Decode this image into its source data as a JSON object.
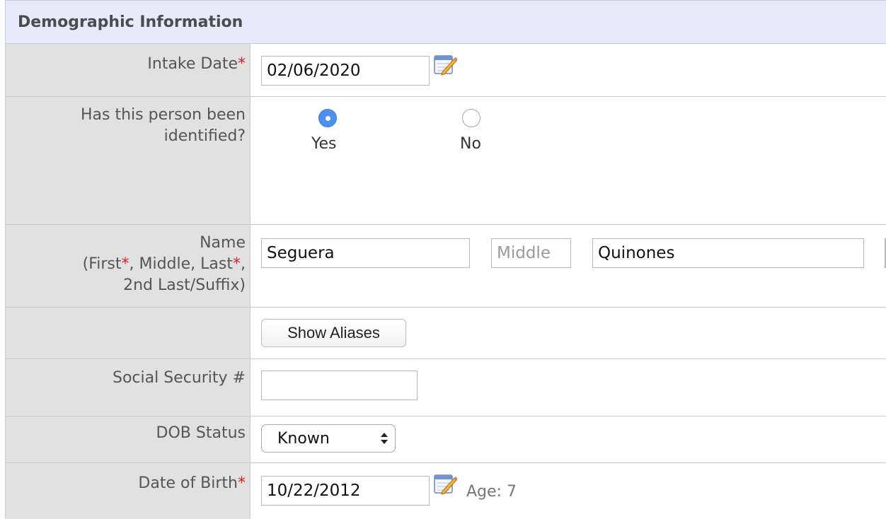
{
  "section": {
    "title": "Demographic Information"
  },
  "intake_date": {
    "label": "Intake Date",
    "required_mark": "*",
    "value": "02/06/2020",
    "calendar_icon": "calendar-edit-icon"
  },
  "identified": {
    "label_line1": "Has this person been",
    "label_line2": "identified?",
    "options": [
      {
        "label": "Yes",
        "checked": true
      },
      {
        "label": "No",
        "checked": false
      }
    ]
  },
  "name": {
    "label_line1": "Name",
    "label_line2_prefix": "(First",
    "label_line2_mid": ", Middle, Last",
    "label_line2_suffix": ",",
    "label_line3": "2nd Last/Suffix)",
    "required_mark": "*",
    "first_value": "Seguera",
    "middle_placeholder": "Middle",
    "last_value": "Quinones"
  },
  "aliases": {
    "button_label": "Show Aliases"
  },
  "ssn": {
    "label": "Social Security #",
    "value": ""
  },
  "dob_status": {
    "label": "DOB Status",
    "selected": "Known"
  },
  "dob": {
    "label": "Date of Birth",
    "required_mark": "*",
    "value": "10/22/2012",
    "calendar_icon": "calendar-edit-icon",
    "age_text": "Age: 7"
  },
  "colors": {
    "header_bg": "#e8e9fb",
    "label_bg": "#e1e1e1",
    "required": "#e02020",
    "radio_checked": "#4d8ff0"
  }
}
